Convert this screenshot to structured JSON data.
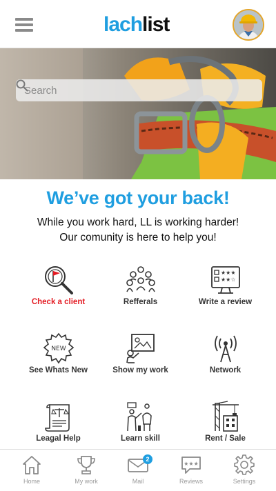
{
  "header": {
    "logo_part1": "lach",
    "logo_part2": "list",
    "menu_icon": "hamburger-menu-icon",
    "avatar_icon": "user-avatar-icon"
  },
  "search": {
    "placeholder": "Search",
    "icon": "search-icon"
  },
  "tagline": {
    "headline": "We’ve got your back!",
    "line1": "While you work hard, LL is working harder!",
    "line2": "Our comunity is here to help you!"
  },
  "features": [
    {
      "label": "Check a client",
      "icon": "check-client-icon",
      "highlight": true
    },
    {
      "label": "Refferals",
      "icon": "referrals-icon"
    },
    {
      "label": "Write a review",
      "icon": "write-review-icon"
    },
    {
      "label": "See Whats New",
      "icon": "new-badge-icon"
    },
    {
      "label": "Show my work",
      "icon": "show-work-icon"
    },
    {
      "label": "Network",
      "icon": "network-icon"
    },
    {
      "label": "Leagal Help",
      "icon": "legal-help-icon"
    },
    {
      "label": "Learn skill",
      "icon": "learn-skill-icon"
    },
    {
      "label": "Rent / Sale",
      "icon": "rent-sale-icon"
    }
  ],
  "new_badge_text": "NEW",
  "bottom_nav": {
    "items": [
      {
        "label": "Home",
        "icon": "home-icon"
      },
      {
        "label": "My work",
        "icon": "trophy-icon"
      },
      {
        "label": "Mail",
        "icon": "mail-icon",
        "badge": "2"
      },
      {
        "label": "Reviews",
        "icon": "reviews-icon"
      },
      {
        "label": "Settings",
        "icon": "gear-icon"
      }
    ]
  },
  "colors": {
    "brand_blue": "#1f9ee0",
    "alert_red": "#e31b23",
    "avatar_ring": "#e3a52a"
  }
}
